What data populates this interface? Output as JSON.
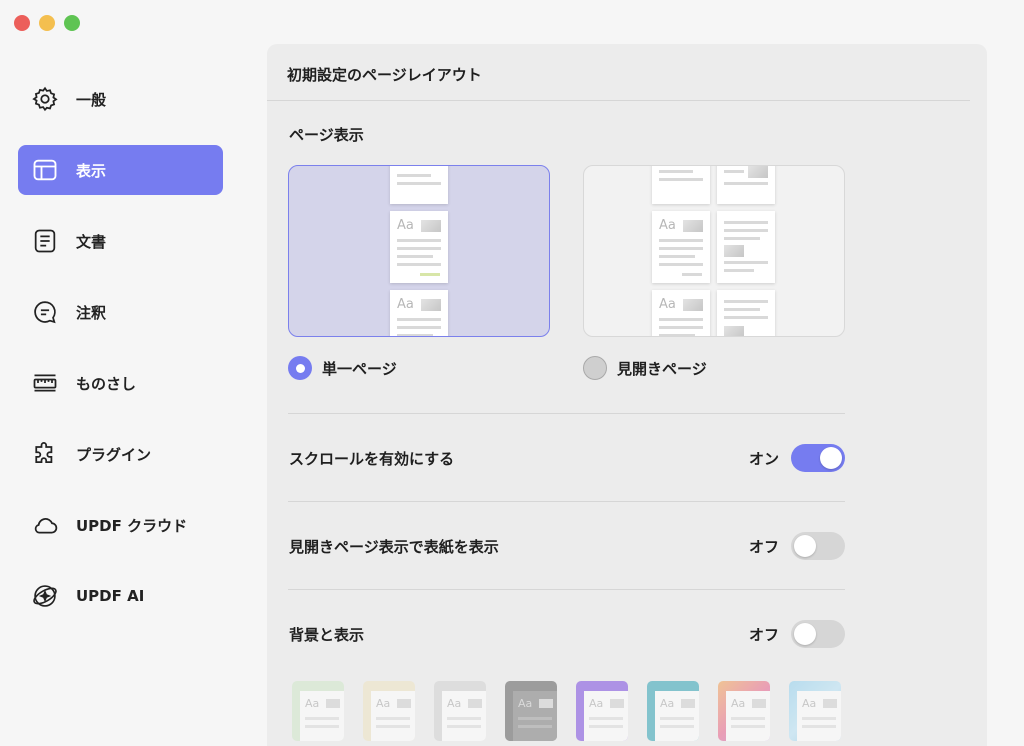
{
  "window": {
    "controls": [
      "close",
      "minimize",
      "maximize"
    ]
  },
  "sidebar": {
    "items": [
      {
        "label": "一般",
        "icon": "gear-icon",
        "active": false
      },
      {
        "label": "表示",
        "icon": "layout-icon",
        "active": true
      },
      {
        "label": "文書",
        "icon": "document-icon",
        "active": false
      },
      {
        "label": "注釈",
        "icon": "comment-icon",
        "active": false
      },
      {
        "label": "ものさし",
        "icon": "ruler-icon",
        "active": false
      },
      {
        "label": "プラグイン",
        "icon": "puzzle-icon",
        "active": false
      },
      {
        "label": "UPDF クラウド",
        "icon": "cloud-icon",
        "active": false
      },
      {
        "label": "UPDF AI",
        "icon": "ai-icon",
        "active": false
      }
    ]
  },
  "main": {
    "header": "初期設定のページレイアウト",
    "page_display": {
      "title": "ページ表示",
      "options": [
        {
          "label": "単一ページ",
          "selected": true
        },
        {
          "label": "見開きページ",
          "selected": false
        }
      ]
    },
    "settings": [
      {
        "label": "スクロールを有効にする",
        "state": "オン",
        "on": true
      },
      {
        "label": "見開きページ表示で表紙を表示",
        "state": "オフ",
        "on": false
      },
      {
        "label": "背景と表示",
        "state": "オフ",
        "on": false
      }
    ],
    "mini_page_text": "Aa",
    "themes": [
      {
        "name": "green",
        "color": "#cfe8c9"
      },
      {
        "name": "cream",
        "color": "#efe3c2"
      },
      {
        "name": "gray",
        "color": "#d2d2d2"
      },
      {
        "name": "dark",
        "color": "#5c5c5c"
      },
      {
        "name": "purple",
        "color": "#7a4ae0"
      },
      {
        "name": "teal",
        "color": "#2fa3b5"
      },
      {
        "name": "sunset",
        "color": "#e8608a"
      },
      {
        "name": "sky",
        "color": "#8fd0f0"
      }
    ]
  },
  "colors": {
    "accent": "#767cf0",
    "selected_card_bg": "#d4d4ea"
  }
}
